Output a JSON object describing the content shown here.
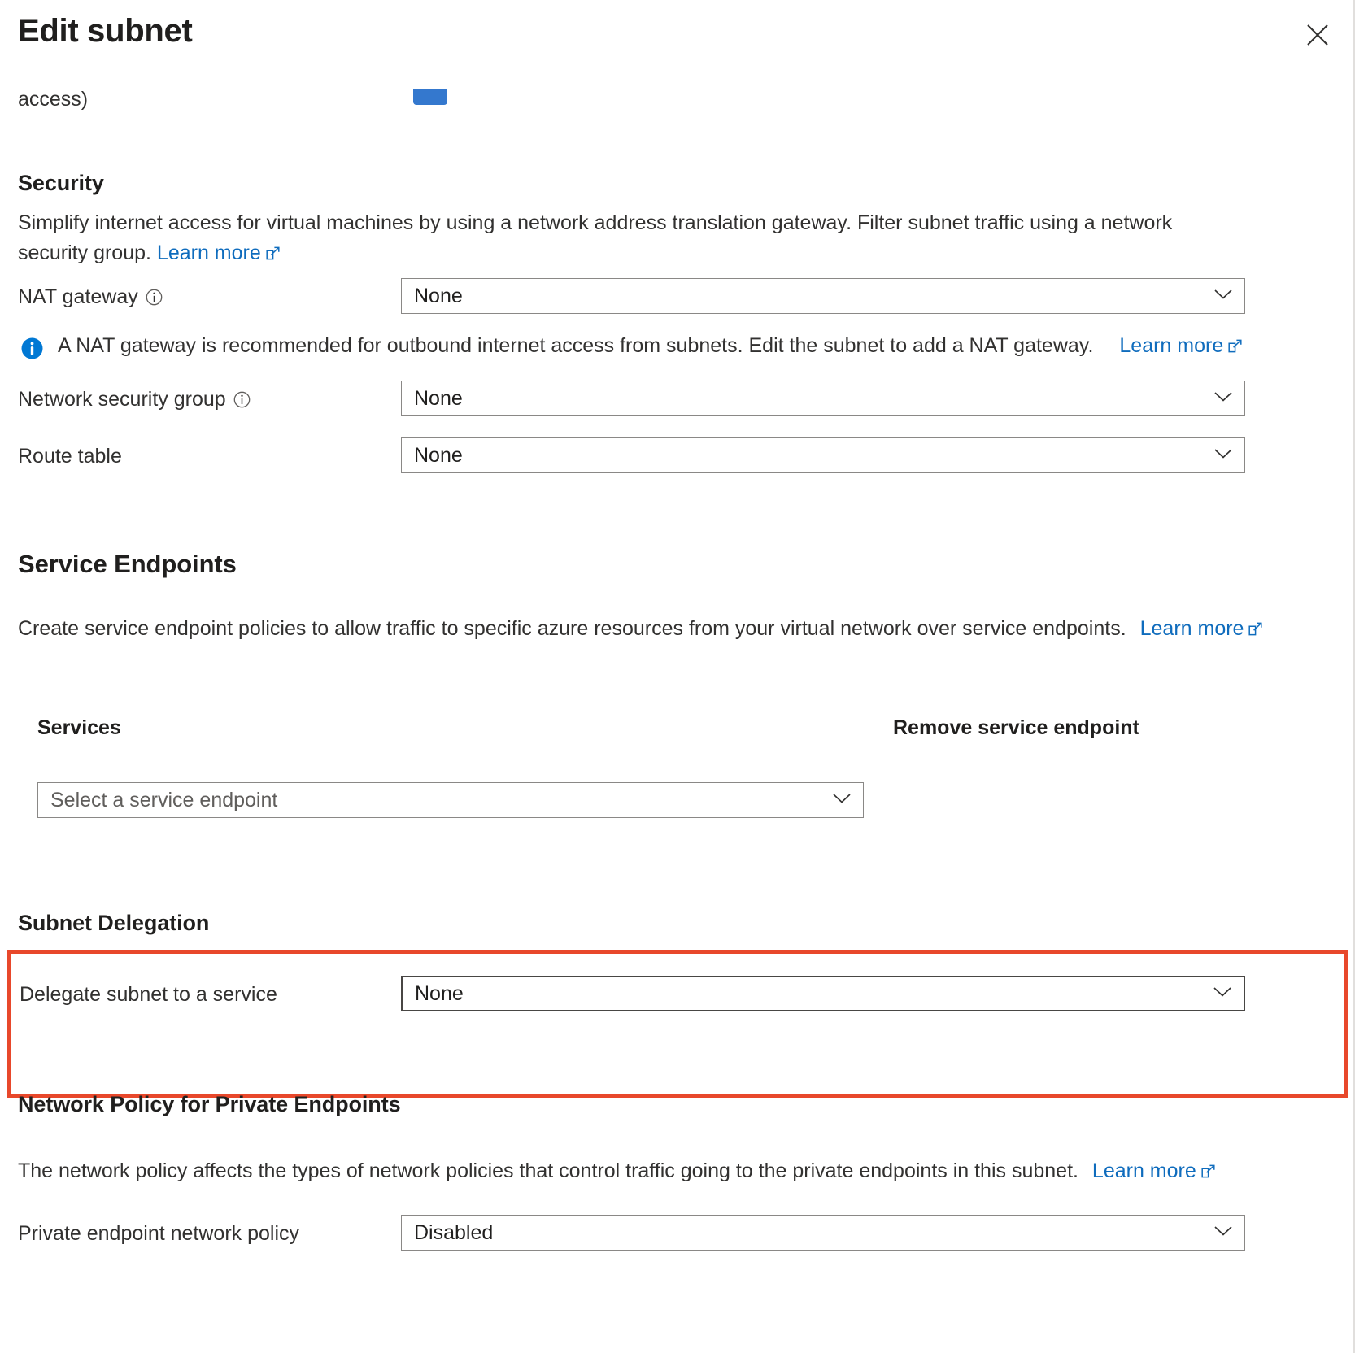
{
  "header": {
    "title": "Edit subnet",
    "close_icon": "close-icon"
  },
  "truncated_text": "access)",
  "security": {
    "heading": "Security",
    "description": "Simplify internet access for virtual machines by using a network address translation gateway. Filter subnet traffic using a network security group.",
    "learn_more": "Learn more",
    "nat_gateway": {
      "label": "NAT gateway",
      "value": "None",
      "info_icon": "info-icon"
    },
    "nat_banner": {
      "icon": "info-filled-icon",
      "text": "A NAT gateway is recommended for outbound internet access from subnets. Edit the subnet to add a NAT gateway.",
      "learn_more": "Learn more"
    },
    "network_security_group": {
      "label": "Network security group",
      "value": "None",
      "info_icon": "info-icon"
    },
    "route_table": {
      "label": "Route table",
      "value": "None"
    }
  },
  "service_endpoints": {
    "heading": "Service Endpoints",
    "description": "Create service endpoint policies to allow traffic to specific azure resources from your virtual network over service endpoints.",
    "learn_more": "Learn more",
    "table": {
      "columns": [
        "Services",
        "Remove service endpoint"
      ],
      "rows": []
    },
    "select_placeholder": "Select a service endpoint"
  },
  "subnet_delegation": {
    "heading": "Subnet Delegation",
    "delegate": {
      "label": "Delegate subnet to a service",
      "value": "None"
    },
    "highlight_color": "#e8482b"
  },
  "network_policy": {
    "heading": "Network Policy for Private Endpoints",
    "description": "The network policy affects the types of network policies that control traffic going to the private endpoints in this subnet.",
    "learn_more": "Learn more",
    "private_endpoint_policy": {
      "label": "Private endpoint network policy",
      "value": "Disabled"
    }
  },
  "colors": {
    "accent": "#0f6cbd",
    "highlight": "#e8482b",
    "info": "#0078d4",
    "chip": "#3478ce"
  }
}
